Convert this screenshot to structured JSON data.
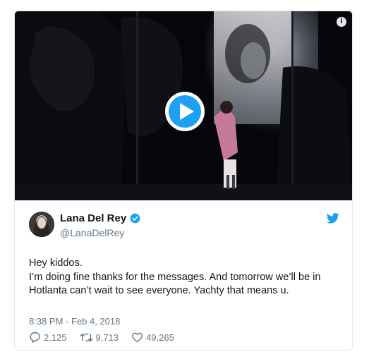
{
  "media": {
    "info_icon": "info-icon",
    "play_icon": "play-icon",
    "accent": "#1da1f2"
  },
  "tweet": {
    "name": "Lana Del Rey",
    "handle": "@LanaDelRey",
    "verified_icon": "verified-badge-icon",
    "brand_icon": "twitter-bird-icon",
    "text": "Hey kiddos.\nI’m doing fine thanks for the messages. And tomorrow we’ll be in Hotlanta can’t wait to see everyone. Yachty that means u.",
    "timestamp": "8:38 PM - Feb 4, 2018"
  },
  "actions": {
    "replies": "2,125",
    "retweets": "9,713",
    "likes": "49,265"
  }
}
